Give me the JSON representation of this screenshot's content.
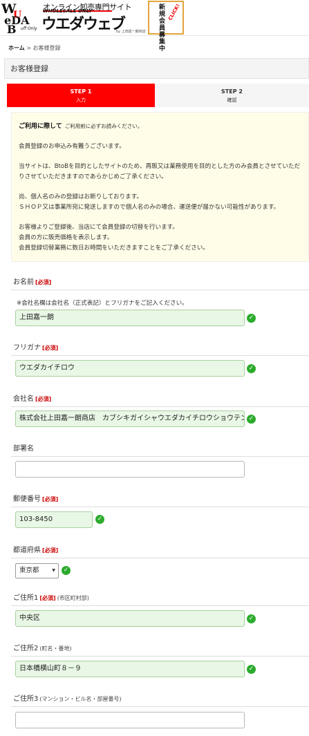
{
  "header": {
    "tagline": "オンライン卸売専門サイト",
    "wholesale": "WHOLESALE ONLY",
    "logo_main": "ウエダウェブ",
    "logo_w": "W",
    "logo_e": "e",
    "logo_u": "U",
    "logo_da": "DA",
    "logo_b": "B",
    "logo_b_small": "uff Only",
    "by_line": "by 上田嘉一朗商店",
    "recruit": "新規会員募集中",
    "recruit_click": "CLICK!"
  },
  "breadcrumb": {
    "home": "ホーム",
    "separator": ">",
    "current": "お客様登録"
  },
  "page_title": "お客様登録",
  "steps": [
    {
      "num": "STEP 1",
      "label": "入力"
    },
    {
      "num": "STEP 2",
      "label": "確認"
    }
  ],
  "notice": {
    "heading": "ご利用に際して",
    "subheading": "ご利用前に必ずお読みください。",
    "line1": "会員登録のお申込み有難うございます。",
    "line2": "当サイトは、BtoBを目的としたサイトのため、再販又は業務使用を目的とした方のみ会員とさせていただ",
    "line3": "りさせていただきますのであらかじめご了承ください。",
    "line4": "尚、個人名のみの登録はお断りしております。",
    "line5": "ＳＨＯＰ又は事業所宛に発送しますので個人名のみの場合、運送便が届かない可能性があります。",
    "line6": "お客様よりご登録後、当店にて会員登録の切替を行います。",
    "line7": "会員の方に販売価格を表示します。",
    "line8": "会員登録切替業務に数日お時間をいただきますことをご了承ください。"
  },
  "form": {
    "required": "[必須]",
    "name": {
      "label": "お名前",
      "hint": "※会社名欄は会社名（正式表記）とフリガナをご記入ください。",
      "value": "上田嘉一朗"
    },
    "furigana": {
      "label": "フリガナ",
      "value": "ウエダカイチロウ"
    },
    "company": {
      "label": "会社名",
      "value": "株式会社上田嘉一朗商店　カブシキガイシャウエダカイチロウショウテン"
    },
    "department": {
      "label": "部署名",
      "value": ""
    },
    "postal": {
      "label": "郵便番号",
      "value": "103-8450"
    },
    "prefecture": {
      "label": "都道府県",
      "value": "東京都"
    },
    "address1": {
      "label": "ご住所1",
      "note": "(市区町村部)",
      "value": "中央区"
    },
    "address2": {
      "label": "ご住所2",
      "note": "(町名・番地)",
      "value": "日本橋横山町８－９"
    },
    "address3": {
      "label": "ご住所3",
      "note": "(マンション・ビル名・部屋番号)",
      "value": ""
    }
  },
  "icons": {
    "check": "check-circle-icon",
    "check_color": "#2cab2c",
    "step_active_color": "#ff0000"
  }
}
